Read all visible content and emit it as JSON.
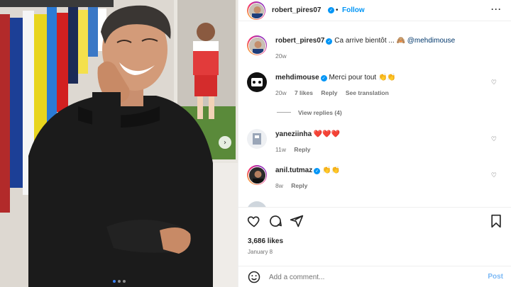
{
  "post": {
    "author": "robert_pires07",
    "follow_label": "Follow",
    "separator": "•",
    "caption": {
      "username": "robert_pires07",
      "text": "Ca arrive bientôt ... 🙈",
      "mention": "@mehdimouse",
      "age": "20w"
    },
    "likes": "3,686 likes",
    "date": "January 8"
  },
  "comments": [
    {
      "username": "mehdimouse",
      "verified": true,
      "text": "Merci pour tout 👏👏",
      "age": "20w",
      "likes": "7 likes",
      "reply": "Reply",
      "translate": "See translation",
      "view_replies": "View replies (4)"
    },
    {
      "username": "yaneziinha",
      "verified": false,
      "text": "❤️❤️❤️",
      "age": "11w",
      "reply": "Reply"
    },
    {
      "username": "anil.tutmaz",
      "verified": true,
      "text": "👏👏",
      "age": "8w",
      "reply": "Reply"
    }
  ],
  "add_comment": {
    "placeholder": "Add a comment...",
    "post_label": "Post"
  },
  "icons": {
    "more": "more-options-icon",
    "heart": "heart-icon",
    "comment": "comment-icon",
    "share": "share-icon",
    "save": "bookmark-icon",
    "emoji": "emoji-icon",
    "next": "chevron-right-icon"
  },
  "colors": {
    "accent": "#0095f6",
    "text": "#262626",
    "muted": "#737373",
    "post_disabled": "#7ab8f5"
  },
  "carousel": {
    "slides": 3,
    "active": 1
  }
}
